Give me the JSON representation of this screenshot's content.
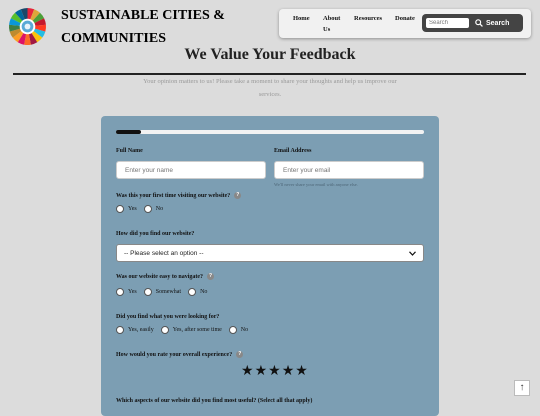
{
  "site": {
    "title": "SUSTAINABLE CITIES & COMMUNITIES"
  },
  "nav": {
    "items": [
      "Home",
      "About Us",
      "Resources",
      "Donate"
    ],
    "search_placeholder": "Search",
    "search_button": "Search"
  },
  "page": {
    "heading": "We Value Your Feedback",
    "intro": "Your opinion matters to us! Please take a moment to share your thoughts and help us improve our services."
  },
  "form": {
    "progress": 0.08,
    "full_name_label": "Full Name",
    "full_name_placeholder": "Enter your name",
    "email_label": "Email Address",
    "email_placeholder": "Enter your email",
    "email_hint": "We'll never share your email with anyone else.",
    "q1": {
      "label": "Was this your first time visiting our website?",
      "options": [
        "Yes",
        "No"
      ]
    },
    "q2": {
      "label": "How did you find our website?",
      "selected": "-- Please select an option --"
    },
    "q3": {
      "label": "Was our website easy to navigate?",
      "options": [
        "Yes",
        "Somewhat",
        "No"
      ]
    },
    "q4": {
      "label": "Did you find what you were looking for?",
      "options": [
        "Yes, easily",
        "Yes, after some time",
        "No"
      ]
    },
    "q5": {
      "label": "How would you rate your overall experience?",
      "stars": 5
    },
    "q6": {
      "label": "Which aspects of our website did you find most useful? (Select all that apply)"
    }
  },
  "help_glyph": "?",
  "scroll_top_glyph": "↑",
  "colors": {
    "card": "#7c9eb3",
    "background": "#dcdcdc",
    "search_box": "#444444"
  }
}
